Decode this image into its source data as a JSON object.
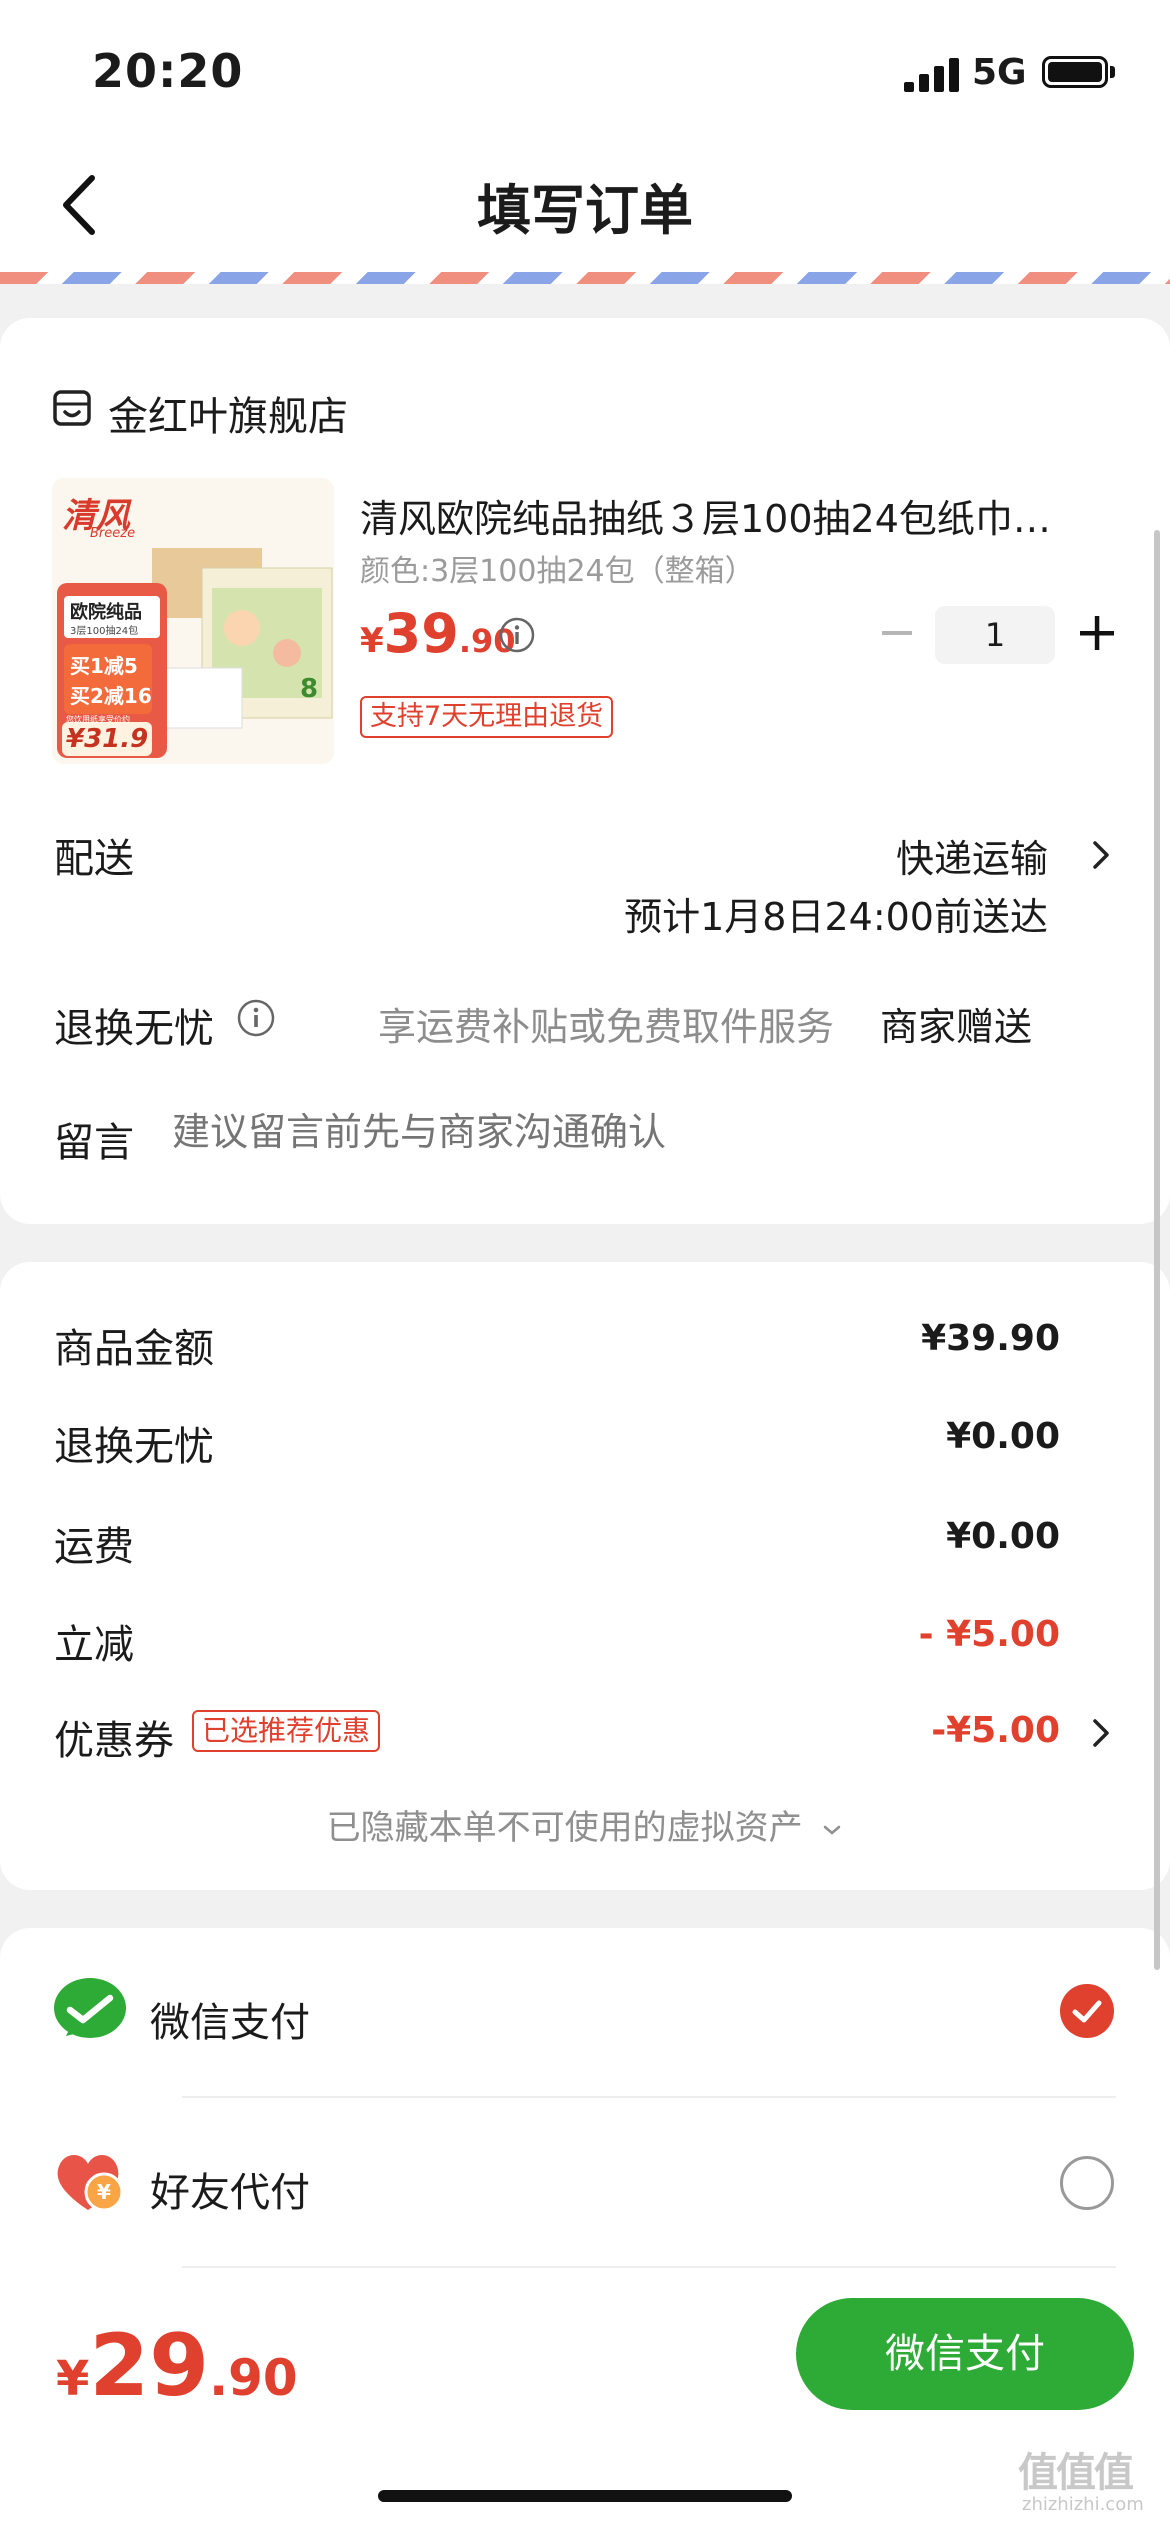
{
  "status_bar": {
    "time": "20:20",
    "network": "5G"
  },
  "nav": {
    "title": "填写订单",
    "back_icon": "chevron-left-icon"
  },
  "store": {
    "icon": "store-icon",
    "name": "金红叶旗舰店"
  },
  "product": {
    "title": "清风欧院纯品抽纸３层100抽24包纸巾…",
    "spec": "颜色:3层100抽24包（整箱）",
    "price_currency": "¥",
    "price_int": "39",
    "price_dec": ".90",
    "quantity": "1",
    "return_badge": "支持7天无理由退货",
    "image": {
      "brand": "清风",
      "brand_sub": "Breeze",
      "tag1": "欧院纯品",
      "tag2": "3层100抽24包",
      "promo1": "买1减5",
      "promo2": "买2减16",
      "note": "您饮用纸享受价约",
      "price": "¥31.9",
      "pkg_count": "8"
    }
  },
  "delivery": {
    "label": "配送",
    "method": "快递运输",
    "eta": "预计1月8日24:00前送达"
  },
  "worry_free": {
    "label": "退换无忧",
    "desc": "享运费补贴或免费取件服务",
    "status": "商家赠送"
  },
  "message": {
    "label": "留言",
    "placeholder": "建议留言前先与商家沟通确认"
  },
  "amounts": {
    "goods_label": "商品金额",
    "goods_value": "¥39.90",
    "worry_label": "退换无忧",
    "worry_value": "¥0.00",
    "shipping_label": "运费",
    "shipping_value": "¥0.00",
    "discount_label": "立减",
    "discount_value": "- ¥5.00",
    "coupon_label": "优惠券",
    "coupon_badge": "已选推荐优惠",
    "coupon_value": "-¥5.00",
    "hidden_assets": "已隐藏本单不可使用的虚拟资产"
  },
  "payment": {
    "wechat_label": "微信支付",
    "friend_label": "好友代付",
    "selected": "wechat"
  },
  "bottom": {
    "total_currency": "¥",
    "total_int": "29",
    "total_dec": ".90",
    "pay_button": "微信支付"
  },
  "watermark": {
    "line1": "值值值",
    "line2": "zhizhizhi.com"
  },
  "colors": {
    "accent_red": "#e0402e",
    "wechat_green": "#2eaa37"
  }
}
